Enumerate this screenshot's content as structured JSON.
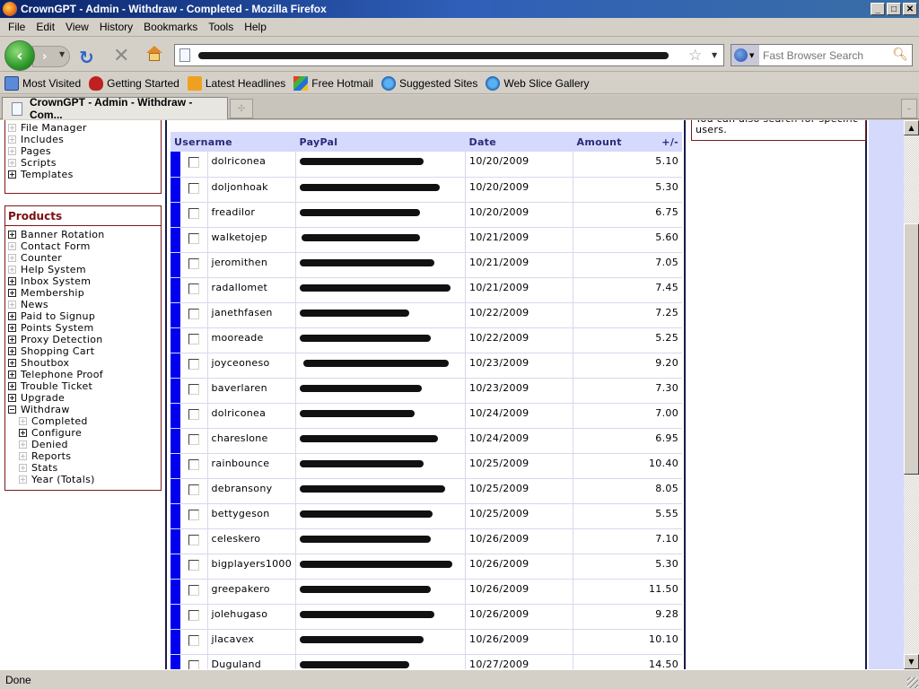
{
  "window": {
    "title": "CrownGPT - Admin - Withdraw - Completed - Mozilla Firefox",
    "buttons": {
      "minimize": "_",
      "maximize": "□",
      "close": "✕"
    }
  },
  "menubar": [
    "File",
    "Edit",
    "View",
    "History",
    "Bookmarks",
    "Tools",
    "Help"
  ],
  "navbar": {
    "back": "‹",
    "forward": "›",
    "reload": "↻",
    "stop": "✕",
    "search_placeholder": "Fast Browser Search"
  },
  "bookmarks": [
    "Most Visited",
    "Getting Started",
    "Latest Headlines",
    "Free Hotmail",
    "Suggested Sites",
    "Web Slice Gallery"
  ],
  "tab": {
    "label": "CrownGPT - Admin - Withdraw - Com..."
  },
  "sidebar": {
    "top_items": [
      {
        "label": "File Manager",
        "expandable": false
      },
      {
        "label": "Includes",
        "expandable": false
      },
      {
        "label": "Pages",
        "expandable": false
      },
      {
        "label": "Scripts",
        "expandable": false
      },
      {
        "label": "Templates",
        "expandable": true
      }
    ],
    "products_title": "Products",
    "products": [
      {
        "label": "Banner Rotation",
        "expandable": true,
        "sub": false
      },
      {
        "label": "Contact Form",
        "expandable": false,
        "sub": false
      },
      {
        "label": "Counter",
        "expandable": false,
        "sub": false
      },
      {
        "label": "Help System",
        "expandable": false,
        "sub": false
      },
      {
        "label": "Inbox System",
        "expandable": true,
        "sub": false
      },
      {
        "label": "Membership",
        "expandable": true,
        "sub": false
      },
      {
        "label": "News",
        "expandable": false,
        "sub": false
      },
      {
        "label": "Paid to Signup",
        "expandable": true,
        "sub": false
      },
      {
        "label": "Points System",
        "expandable": true,
        "sub": false
      },
      {
        "label": "Proxy Detection",
        "expandable": true,
        "sub": false
      },
      {
        "label": "Shopping Cart",
        "expandable": true,
        "sub": false
      },
      {
        "label": "Shoutbox",
        "expandable": true,
        "sub": false
      },
      {
        "label": "Telephone Proof",
        "expandable": true,
        "sub": false
      },
      {
        "label": "Trouble Ticket",
        "expandable": true,
        "sub": false
      },
      {
        "label": "Upgrade",
        "expandable": true,
        "sub": false
      },
      {
        "label": "Withdraw",
        "expandable": true,
        "expanded": true,
        "sub": false
      },
      {
        "label": "Completed",
        "expandable": false,
        "sub": true
      },
      {
        "label": "Configure",
        "expandable": true,
        "sub": true
      },
      {
        "label": "Denied",
        "expandable": false,
        "sub": true
      },
      {
        "label": "Reports",
        "expandable": false,
        "sub": true
      },
      {
        "label": "Stats",
        "expandable": false,
        "sub": true
      },
      {
        "label": "Year (Totals)",
        "expandable": false,
        "sub": true
      }
    ]
  },
  "table": {
    "headers": {
      "username": "Username",
      "paypal": "PayPal",
      "date": "Date",
      "amount": "Amount",
      "plusminus": "+/-"
    },
    "row_bar_color": "#0000ee",
    "rows": [
      {
        "username": "dolriconea",
        "paypal": "[redacted]",
        "date": "10/20/2009",
        "amount": "5.10"
      },
      {
        "username": "doljonhoak",
        "paypal": "[redacted]",
        "date": "10/20/2009",
        "amount": "5.30"
      },
      {
        "username": "freadilor",
        "paypal": "[redacted]",
        "date": "10/20/2009",
        "amount": "6.75"
      },
      {
        "username": "walketojep",
        "paypal": "[redacted]",
        "date": "10/21/2009",
        "amount": "5.60"
      },
      {
        "username": "jeromithen",
        "paypal": "[redacted]",
        "date": "10/21/2009",
        "amount": "7.05"
      },
      {
        "username": "radallomet",
        "paypal": "[redacted]",
        "date": "10/21/2009",
        "amount": "7.45"
      },
      {
        "username": "janethfasen",
        "paypal": "[redacted]",
        "date": "10/22/2009",
        "amount": "7.25"
      },
      {
        "username": "mooreade",
        "paypal": "[redacted]",
        "date": "10/22/2009",
        "amount": "5.25"
      },
      {
        "username": "joyceoneso",
        "paypal": "[redacted]",
        "date": "10/23/2009",
        "amount": "9.20"
      },
      {
        "username": "baverlaren",
        "paypal": "[redacted]",
        "date": "10/23/2009",
        "amount": "7.30"
      },
      {
        "username": "dolriconea",
        "paypal": "[redacted]",
        "date": "10/24/2009",
        "amount": "7.00"
      },
      {
        "username": "chareslone",
        "paypal": "[redacted]",
        "date": "10/24/2009",
        "amount": "6.95"
      },
      {
        "username": "rainbounce",
        "paypal": "[redacted]",
        "date": "10/25/2009",
        "amount": "10.40"
      },
      {
        "username": "debransony",
        "paypal": "[redacted]",
        "date": "10/25/2009",
        "amount": "8.05"
      },
      {
        "username": "bettygeson",
        "paypal": "[redacted]",
        "date": "10/25/2009",
        "amount": "5.55"
      },
      {
        "username": "celeskero",
        "paypal": "[redacted]",
        "date": "10/26/2009",
        "amount": "7.10"
      },
      {
        "username": "bigplayers1000",
        "paypal": "[redacted]",
        "date": "10/26/2009",
        "amount": "5.30"
      },
      {
        "username": "greepakero",
        "paypal": "[redacted]",
        "date": "10/26/2009",
        "amount": "11.50"
      },
      {
        "username": "jolehugaso",
        "paypal": "[redacted]",
        "date": "10/26/2009",
        "amount": "9.28"
      },
      {
        "username": "jlacavex",
        "paypal": "[redacted]",
        "date": "10/26/2009",
        "amount": "10.10"
      },
      {
        "username": "Duguland",
        "paypal": "[redacted]",
        "date": "10/27/2009",
        "amount": "14.50"
      }
    ]
  },
  "info_box": {
    "text": "You can also search for specific users."
  },
  "status": {
    "text": "Done"
  }
}
